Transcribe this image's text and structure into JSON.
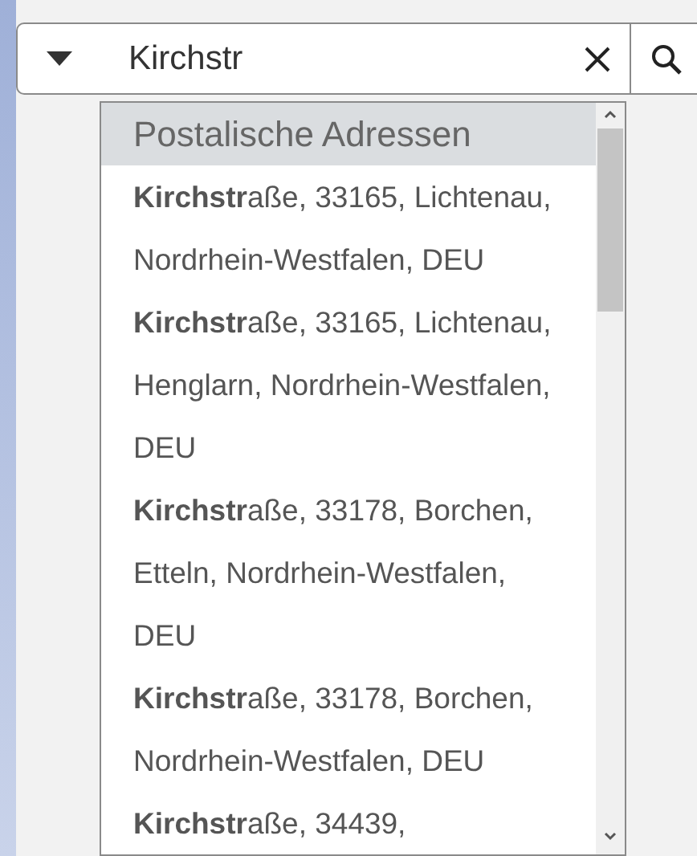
{
  "search": {
    "value": "Kirchstr"
  },
  "dropdown": {
    "header": "Postalische Adressen",
    "items": [
      "**Kirchstr**aße, 33165, Lichtenau, Nordrhein-Westfalen, DEU",
      "**Kirchstr**aße, 33165, Lichtenau, Henglarn, Nordrhein-Westfalen, DEU",
      "**Kirchstr**aße, 33178, Borchen, Etteln, Nordrhein-Westfalen, DEU",
      "**Kirchstr**aße, 33178, Borchen, Nordrhein-Westfalen, DEU",
      "**Kirchstr**aße, 34439,"
    ]
  }
}
